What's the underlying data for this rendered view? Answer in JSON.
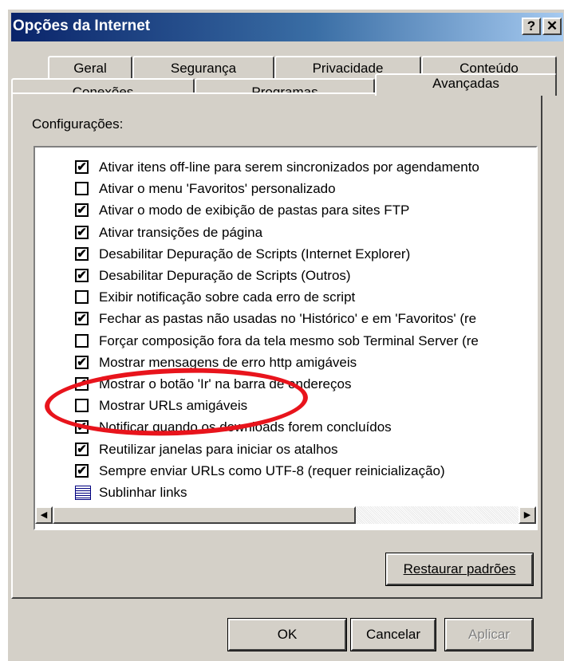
{
  "window": {
    "title": "Opções da Internet",
    "help_label": "?",
    "close_label": "✕"
  },
  "tabs_row1": [
    "Geral",
    "Segurança",
    "Privacidade",
    "Conteúdo"
  ],
  "tabs_row2": [
    "Conexões",
    "Programas",
    "Avançadas"
  ],
  "active_tab": "Avançadas",
  "settings_label": "Configurações:",
  "settings": [
    {
      "label": "Ativar itens off-line para serem sincronizados por agendamento",
      "checked": true
    },
    {
      "label": "Ativar o menu 'Favoritos' personalizado",
      "checked": false
    },
    {
      "label": "Ativar o modo de exibição de pastas para sites FTP",
      "checked": true
    },
    {
      "label": "Ativar transições de página",
      "checked": true
    },
    {
      "label": "Desabilitar Depuração de Scripts (Internet Explorer)",
      "checked": true
    },
    {
      "label": "Desabilitar Depuração de Scripts (Outros)",
      "checked": true
    },
    {
      "label": "Exibir notificação sobre cada erro de script",
      "checked": false
    },
    {
      "label": "Fechar as pastas não usadas no 'Histórico' e em 'Favoritos' (re",
      "checked": true
    },
    {
      "label": "Forçar composição fora da tela mesmo sob Terminal Server (re",
      "checked": false
    },
    {
      "label": "Mostrar mensagens de erro http amigáveis",
      "checked": true
    },
    {
      "label": "Mostrar o botão 'Ir' na barra de endereços",
      "checked": true
    },
    {
      "label": "Mostrar URLs amigáveis",
      "checked": false
    },
    {
      "label": "Notificar quando os downloads forem concluídos",
      "checked": true
    },
    {
      "label": "Reutilizar janelas para iniciar os atalhos",
      "checked": true
    },
    {
      "label": "Sempre enviar URLs como UTF-8 (requer reinicialização)",
      "checked": true
    },
    {
      "label": "Sublinhar links",
      "checked": null,
      "icon": "category-icon"
    }
  ],
  "buttons": {
    "restore": "Restaurar padrões",
    "ok": "OK",
    "cancel": "Cancelar",
    "apply": "Aplicar"
  },
  "colors": {
    "highlight_ellipse": "#e8141c",
    "titlebar": "#0a246a"
  }
}
